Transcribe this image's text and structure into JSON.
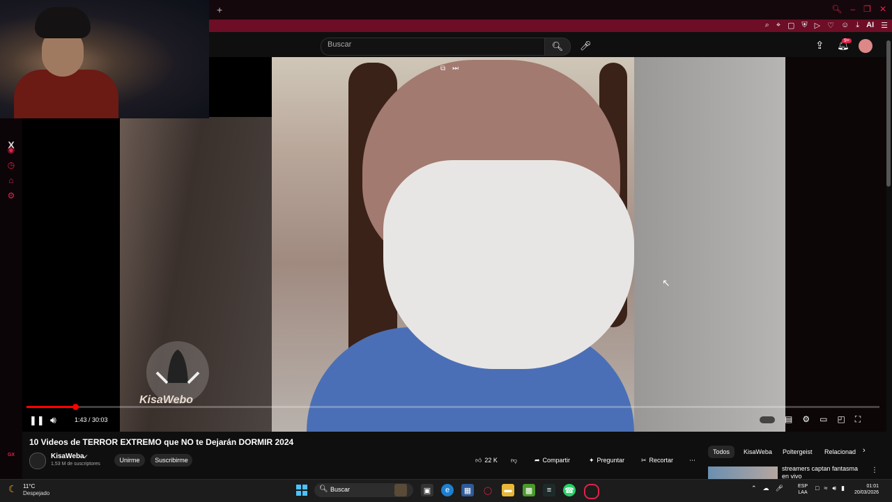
{
  "browser": {
    "new_tab": "+",
    "ai_label": "AI",
    "sidebar_icons": [
      "x-icon",
      "play-icon",
      "clock-icon",
      "tag-icon",
      "settings-icon"
    ],
    "gx_label": "GX"
  },
  "header": {
    "search_placeholder": "Buscar",
    "notification_badge": "9+"
  },
  "player": {
    "watermark": "KisaWebo",
    "time": "1:43 / 30:03",
    "progress": 0.057
  },
  "video": {
    "title": "10 Videos de TERROR EXTREMO que NO te Dejarán DORMIR 2024",
    "channel": "KisaWeba",
    "subscribers": "1,53 M de suscriptores",
    "join": "Unirme",
    "subscribe": "Suscribirme",
    "likes": "22 K",
    "share": "Compartir",
    "ask": "Preguntar",
    "clip": "Recortar"
  },
  "chips": [
    "Todos",
    "KisaWeba",
    "Poltergeist",
    "Relacionad"
  ],
  "recommendation": {
    "title": "streamers captan fantasma en vivo"
  },
  "taskbar": {
    "temp": "11°C",
    "condition": "Despejado",
    "search": "Buscar",
    "lang1": "ESP",
    "lang2": "LAA",
    "time": "01:01",
    "date": "20/03/2026"
  },
  "colors": {
    "accent": "#e2224a",
    "youtube_red": "#ff0000",
    "addrbar": "#6d0d26"
  }
}
